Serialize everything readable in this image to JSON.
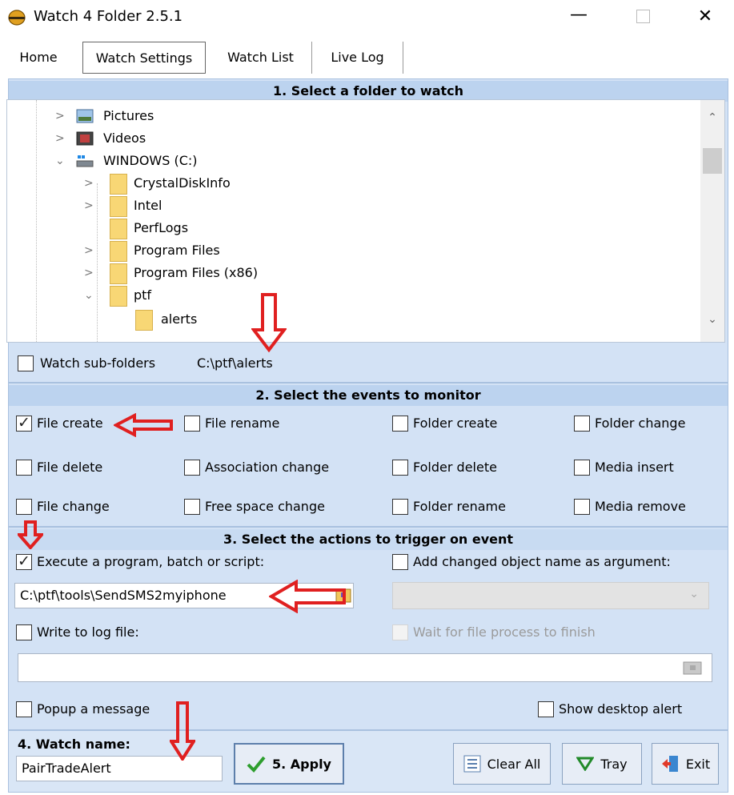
{
  "window": {
    "title": "Watch 4 Folder 2.5.1",
    "minimize": "—",
    "close": "✕"
  },
  "tabs": [
    {
      "label": "Home"
    },
    {
      "label": "Watch Settings"
    },
    {
      "label": "Watch List"
    },
    {
      "label": "Live Log"
    }
  ],
  "section1": {
    "heading": "1. Select a folder to watch",
    "tree": [
      {
        "label": "Pictures"
      },
      {
        "label": "Videos"
      },
      {
        "label": "WINDOWS (C:)"
      },
      {
        "label": "CrystalDiskInfo"
      },
      {
        "label": "Intel"
      },
      {
        "label": "PerfLogs"
      },
      {
        "label": "Program Files"
      },
      {
        "label": "Program Files (x86)"
      },
      {
        "label": "ptf"
      },
      {
        "label": "alerts"
      }
    ],
    "watch_subfolders_label": "Watch sub-folders",
    "selected_path": "C:\\ptf\\alerts"
  },
  "section2": {
    "heading": "2. Select the events to monitor",
    "events": {
      "file_create": "File create",
      "file_rename": "File rename",
      "folder_create": "Folder create",
      "folder_change": "Folder change",
      "file_delete": "File delete",
      "association_change": "Association change",
      "folder_delete": "Folder delete",
      "media_insert": "Media insert",
      "file_change": "File change",
      "free_space_change": "Free space change",
      "folder_rename": "Folder rename",
      "media_remove": "Media remove"
    }
  },
  "section3": {
    "heading": "3. Select the actions to trigger on event",
    "execute_label": "Execute a program, batch or script:",
    "add_arg_label": "Add changed object name as argument:",
    "program_path": "C:\\ptf\\tools\\SendSMS2myiphone",
    "write_log_label": "Write to log file:",
    "wait_label": "Wait for file process to finish",
    "log_path": "",
    "popup_label": "Popup a message",
    "desktop_alert_label": "Show desktop alert"
  },
  "section4": {
    "heading": "4. Watch name:",
    "watch_name": "PairTradeAlert",
    "apply_label": "5. Apply",
    "clear_label": "Clear All",
    "tray_label": "Tray",
    "exit_label": "Exit"
  },
  "colors": {
    "panel": "#d3e2f5",
    "header": "#bcd3ef",
    "arrow": "#e02020",
    "apply_check": "#2e9e2e"
  },
  "icons": [
    "app-icon",
    "folder-icon",
    "pictures-icon",
    "videos-icon",
    "drive-icon",
    "browse-icon",
    "checkmark-icon",
    "list-icon",
    "triangle-down-icon",
    "exit-door-icon"
  ]
}
